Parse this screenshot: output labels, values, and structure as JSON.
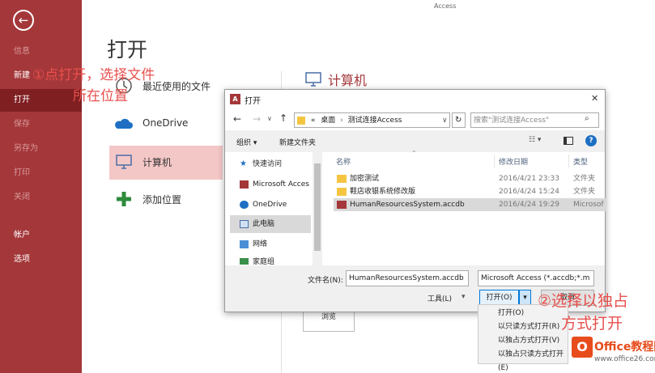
{
  "app": {
    "title": "Access"
  },
  "sidebar": {
    "back_icon": "back-arrow-icon",
    "items": [
      {
        "label": "信息"
      },
      {
        "label": "新建"
      },
      {
        "label": "打开"
      },
      {
        "label": "保存"
      },
      {
        "label": "另存为"
      },
      {
        "label": "打印"
      },
      {
        "label": "关闭"
      },
      {
        "label": "帐户"
      },
      {
        "label": "选项"
      }
    ]
  },
  "main": {
    "heading": "打开",
    "locations": [
      {
        "label": "最近使用的文件",
        "icon": "clock-icon"
      },
      {
        "label": "OneDrive",
        "icon": "cloud-icon"
      },
      {
        "label": "计算机",
        "icon": "computer-icon"
      },
      {
        "label": "添加位置",
        "icon": "plus-icon"
      }
    ],
    "right_heading": "计算机",
    "browse_label": "浏览"
  },
  "annotations": {
    "step1_line1": "①点打开，选择文件",
    "step1_line2": "所在位置",
    "step2_line1": "②选择以独占",
    "step2_line2": "方式打开"
  },
  "dialog": {
    "title": "打开",
    "close": "✕",
    "path_prefix": "«",
    "path": [
      "桌面",
      "测试连接Access"
    ],
    "search_placeholder": "搜索\"测试连接Access\"",
    "toolbar": {
      "organize": "组织 ▾",
      "new_folder": "新建文件夹"
    },
    "nav_tree": [
      {
        "label": "快速访问",
        "icon": "star-icon"
      },
      {
        "label": "Microsoft Acces",
        "icon": "access-icon"
      },
      {
        "label": "OneDrive",
        "icon": "cloud-icon"
      },
      {
        "label": "此电脑",
        "icon": "pc-icon"
      },
      {
        "label": "网络",
        "icon": "network-icon"
      },
      {
        "label": "家庭组",
        "icon": "homegroup-icon"
      }
    ],
    "columns": {
      "name": "名称",
      "date": "修改日期",
      "type": "类型"
    },
    "files": [
      {
        "name": "加密测试",
        "date": "2016/4/21 23:33",
        "type": "文件夹",
        "icon": "folder-icon"
      },
      {
        "name": "鞋店收银系统修改版",
        "date": "2016/4/24 15:24",
        "type": "文件夹",
        "icon": "folder-icon"
      },
      {
        "name": "HumanResourcesSystem.accdb",
        "date": "2016/4/24 19:29",
        "type": "Microsof",
        "icon": "access-file-icon"
      }
    ],
    "filename_label": "文件名(N):",
    "filename_value": "HumanResourcesSystem.accdb",
    "filter_value": "Microsoft Access (*.accdb;*.m",
    "tools_label": "工具(L)",
    "tools_arrow": "▾",
    "open_label": "打开(O)",
    "cancel_label": "取消",
    "open_menu": [
      "打开(O)",
      "以只读方式打开(R)",
      "以独占方式打开(V)",
      "以独占只读方式打开(E)"
    ]
  },
  "watermark": {
    "text": "Office教程网",
    "url": "www.office26.com"
  },
  "colors": {
    "accent": "#a4373a",
    "selected_nav": "#801f22",
    "annotation": "#e8504d",
    "location_selected": "#f4c7c7"
  }
}
